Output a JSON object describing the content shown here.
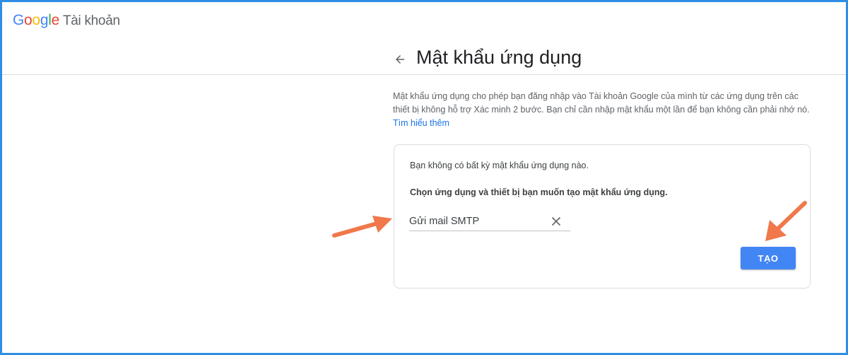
{
  "header": {
    "logo_letters": [
      "G",
      "o",
      "o",
      "g",
      "l",
      "e"
    ],
    "product": "Tài khoản"
  },
  "page": {
    "title": "Mật khẩu ứng dụng",
    "intro": "Mật khẩu ứng dụng cho phép bạn đăng nhập vào Tài khoản Google của mình từ các ứng dụng trên các thiết bị không hỗ trợ Xác minh 2 bước. Bạn chỉ cần nhập mật khẩu một lần để bạn không cần phải nhớ nó.",
    "learn_more": "Tìm hiểu thêm"
  },
  "card": {
    "no_passwords": "Bạn không có bất kỳ mật khẩu ứng dụng nào.",
    "choose": "Chọn ứng dụng và thiết bị bạn muốn tạo mật khẩu ứng dụng.",
    "app_name_value": "Gửi mail SMTP",
    "create_label": "TẠO"
  },
  "icons": {
    "back": "arrow-back-icon",
    "clear": "close-icon",
    "annotation": "orange-arrow-icon"
  },
  "colors": {
    "frame": "#2f8de4",
    "button": "#4285f4",
    "link": "#1a73e8",
    "annotation": "#f0784a"
  }
}
